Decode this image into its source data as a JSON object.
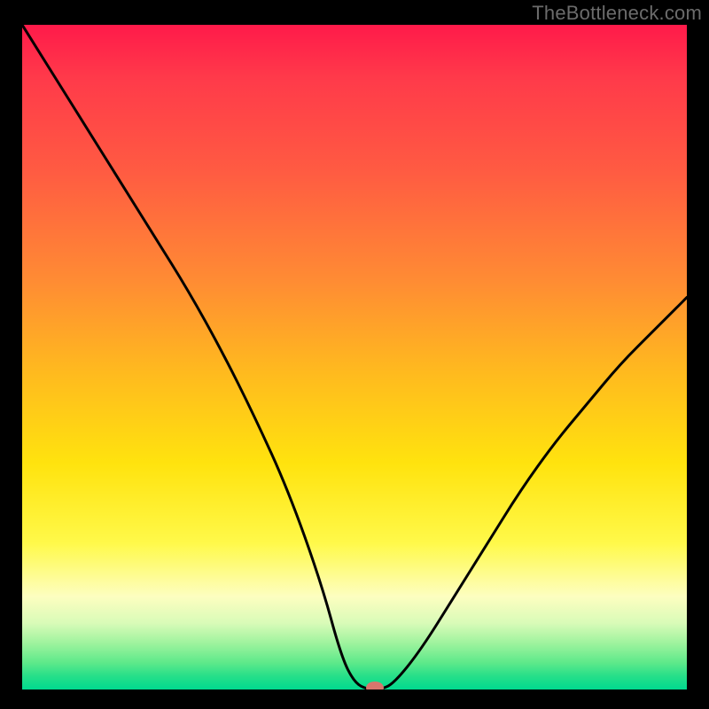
{
  "watermark": "TheBottleneck.com",
  "chart_data": {
    "type": "line",
    "title": "",
    "xlabel": "",
    "ylabel": "",
    "xlim": [
      0,
      100
    ],
    "ylim": [
      0,
      100
    ],
    "grid": false,
    "legend": false,
    "series": [
      {
        "name": "bottleneck-curve",
        "x": [
          0,
          5,
          10,
          15,
          20,
          25,
          30,
          35,
          40,
          45,
          48,
          50,
          52,
          54,
          56,
          60,
          65,
          70,
          75,
          80,
          85,
          90,
          95,
          100
        ],
        "values": [
          100,
          92,
          84,
          76,
          68,
          60,
          51,
          41,
          30,
          16,
          5,
          1,
          0,
          0,
          1,
          6,
          14,
          22,
          30,
          37,
          43,
          49,
          54,
          59
        ]
      }
    ],
    "marker": {
      "x": 53,
      "y": 0.3
    },
    "background_gradient": {
      "stops": [
        {
          "pos": 0.0,
          "color": "#ff1a4a"
        },
        {
          "pos": 0.22,
          "color": "#ff5b42"
        },
        {
          "pos": 0.52,
          "color": "#ffb91f"
        },
        {
          "pos": 0.78,
          "color": "#fff94a"
        },
        {
          "pos": 0.93,
          "color": "#9ff39e"
        },
        {
          "pos": 1.0,
          "color": "#00d98f"
        }
      ]
    }
  }
}
